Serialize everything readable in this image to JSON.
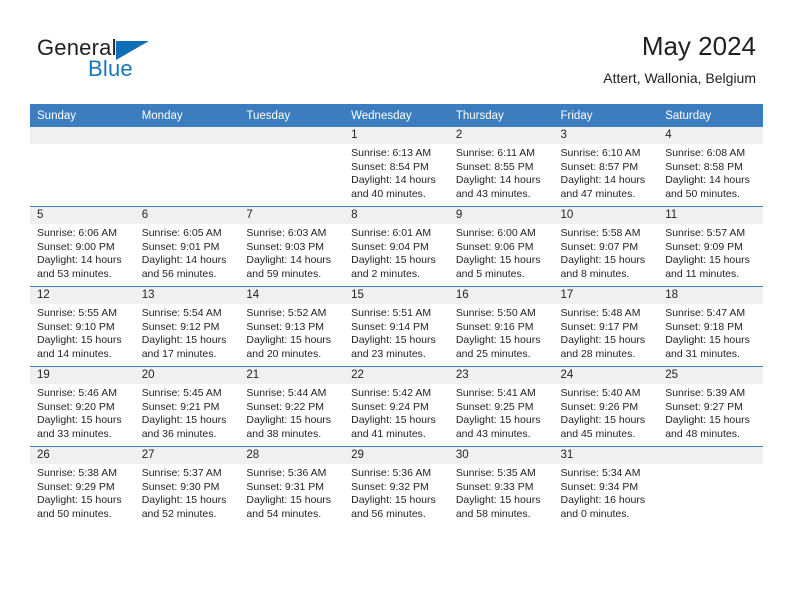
{
  "brand": {
    "name_part1": "General",
    "name_part2": "Blue",
    "triangle_color": "#0e6eb8",
    "blue_color": "#1b75bb"
  },
  "header": {
    "title": "May 2024",
    "subtitle": "Attert, Wallonia, Belgium"
  },
  "theme": {
    "header_row_bg": "#3b7dbf",
    "daynum_band_bg": "#f0f0f0",
    "text_color": "#231f20"
  },
  "weekday_headers": [
    "Sunday",
    "Monday",
    "Tuesday",
    "Wednesday",
    "Thursday",
    "Friday",
    "Saturday"
  ],
  "weeks": [
    [
      {
        "empty": true
      },
      {
        "empty": true
      },
      {
        "empty": true
      },
      {
        "day": "1",
        "sunrise": "Sunrise: 6:13 AM",
        "sunset": "Sunset: 8:54 PM",
        "daylight1": "Daylight: 14 hours",
        "daylight2": "and 40 minutes."
      },
      {
        "day": "2",
        "sunrise": "Sunrise: 6:11 AM",
        "sunset": "Sunset: 8:55 PM",
        "daylight1": "Daylight: 14 hours",
        "daylight2": "and 43 minutes."
      },
      {
        "day": "3",
        "sunrise": "Sunrise: 6:10 AM",
        "sunset": "Sunset: 8:57 PM",
        "daylight1": "Daylight: 14 hours",
        "daylight2": "and 47 minutes."
      },
      {
        "day": "4",
        "sunrise": "Sunrise: 6:08 AM",
        "sunset": "Sunset: 8:58 PM",
        "daylight1": "Daylight: 14 hours",
        "daylight2": "and 50 minutes."
      }
    ],
    [
      {
        "day": "5",
        "sunrise": "Sunrise: 6:06 AM",
        "sunset": "Sunset: 9:00 PM",
        "daylight1": "Daylight: 14 hours",
        "daylight2": "and 53 minutes."
      },
      {
        "day": "6",
        "sunrise": "Sunrise: 6:05 AM",
        "sunset": "Sunset: 9:01 PM",
        "daylight1": "Daylight: 14 hours",
        "daylight2": "and 56 minutes."
      },
      {
        "day": "7",
        "sunrise": "Sunrise: 6:03 AM",
        "sunset": "Sunset: 9:03 PM",
        "daylight1": "Daylight: 14 hours",
        "daylight2": "and 59 minutes."
      },
      {
        "day": "8",
        "sunrise": "Sunrise: 6:01 AM",
        "sunset": "Sunset: 9:04 PM",
        "daylight1": "Daylight: 15 hours",
        "daylight2": "and 2 minutes."
      },
      {
        "day": "9",
        "sunrise": "Sunrise: 6:00 AM",
        "sunset": "Sunset: 9:06 PM",
        "daylight1": "Daylight: 15 hours",
        "daylight2": "and 5 minutes."
      },
      {
        "day": "10",
        "sunrise": "Sunrise: 5:58 AM",
        "sunset": "Sunset: 9:07 PM",
        "daylight1": "Daylight: 15 hours",
        "daylight2": "and 8 minutes."
      },
      {
        "day": "11",
        "sunrise": "Sunrise: 5:57 AM",
        "sunset": "Sunset: 9:09 PM",
        "daylight1": "Daylight: 15 hours",
        "daylight2": "and 11 minutes."
      }
    ],
    [
      {
        "day": "12",
        "sunrise": "Sunrise: 5:55 AM",
        "sunset": "Sunset: 9:10 PM",
        "daylight1": "Daylight: 15 hours",
        "daylight2": "and 14 minutes."
      },
      {
        "day": "13",
        "sunrise": "Sunrise: 5:54 AM",
        "sunset": "Sunset: 9:12 PM",
        "daylight1": "Daylight: 15 hours",
        "daylight2": "and 17 minutes."
      },
      {
        "day": "14",
        "sunrise": "Sunrise: 5:52 AM",
        "sunset": "Sunset: 9:13 PM",
        "daylight1": "Daylight: 15 hours",
        "daylight2": "and 20 minutes."
      },
      {
        "day": "15",
        "sunrise": "Sunrise: 5:51 AM",
        "sunset": "Sunset: 9:14 PM",
        "daylight1": "Daylight: 15 hours",
        "daylight2": "and 23 minutes."
      },
      {
        "day": "16",
        "sunrise": "Sunrise: 5:50 AM",
        "sunset": "Sunset: 9:16 PM",
        "daylight1": "Daylight: 15 hours",
        "daylight2": "and 25 minutes."
      },
      {
        "day": "17",
        "sunrise": "Sunrise: 5:48 AM",
        "sunset": "Sunset: 9:17 PM",
        "daylight1": "Daylight: 15 hours",
        "daylight2": "and 28 minutes."
      },
      {
        "day": "18",
        "sunrise": "Sunrise: 5:47 AM",
        "sunset": "Sunset: 9:18 PM",
        "daylight1": "Daylight: 15 hours",
        "daylight2": "and 31 minutes."
      }
    ],
    [
      {
        "day": "19",
        "sunrise": "Sunrise: 5:46 AM",
        "sunset": "Sunset: 9:20 PM",
        "daylight1": "Daylight: 15 hours",
        "daylight2": "and 33 minutes."
      },
      {
        "day": "20",
        "sunrise": "Sunrise: 5:45 AM",
        "sunset": "Sunset: 9:21 PM",
        "daylight1": "Daylight: 15 hours",
        "daylight2": "and 36 minutes."
      },
      {
        "day": "21",
        "sunrise": "Sunrise: 5:44 AM",
        "sunset": "Sunset: 9:22 PM",
        "daylight1": "Daylight: 15 hours",
        "daylight2": "and 38 minutes."
      },
      {
        "day": "22",
        "sunrise": "Sunrise: 5:42 AM",
        "sunset": "Sunset: 9:24 PM",
        "daylight1": "Daylight: 15 hours",
        "daylight2": "and 41 minutes."
      },
      {
        "day": "23",
        "sunrise": "Sunrise: 5:41 AM",
        "sunset": "Sunset: 9:25 PM",
        "daylight1": "Daylight: 15 hours",
        "daylight2": "and 43 minutes."
      },
      {
        "day": "24",
        "sunrise": "Sunrise: 5:40 AM",
        "sunset": "Sunset: 9:26 PM",
        "daylight1": "Daylight: 15 hours",
        "daylight2": "and 45 minutes."
      },
      {
        "day": "25",
        "sunrise": "Sunrise: 5:39 AM",
        "sunset": "Sunset: 9:27 PM",
        "daylight1": "Daylight: 15 hours",
        "daylight2": "and 48 minutes."
      }
    ],
    [
      {
        "day": "26",
        "sunrise": "Sunrise: 5:38 AM",
        "sunset": "Sunset: 9:29 PM",
        "daylight1": "Daylight: 15 hours",
        "daylight2": "and 50 minutes."
      },
      {
        "day": "27",
        "sunrise": "Sunrise: 5:37 AM",
        "sunset": "Sunset: 9:30 PM",
        "daylight1": "Daylight: 15 hours",
        "daylight2": "and 52 minutes."
      },
      {
        "day": "28",
        "sunrise": "Sunrise: 5:36 AM",
        "sunset": "Sunset: 9:31 PM",
        "daylight1": "Daylight: 15 hours",
        "daylight2": "and 54 minutes."
      },
      {
        "day": "29",
        "sunrise": "Sunrise: 5:36 AM",
        "sunset": "Sunset: 9:32 PM",
        "daylight1": "Daylight: 15 hours",
        "daylight2": "and 56 minutes."
      },
      {
        "day": "30",
        "sunrise": "Sunrise: 5:35 AM",
        "sunset": "Sunset: 9:33 PM",
        "daylight1": "Daylight: 15 hours",
        "daylight2": "and 58 minutes."
      },
      {
        "day": "31",
        "sunrise": "Sunrise: 5:34 AM",
        "sunset": "Sunset: 9:34 PM",
        "daylight1": "Daylight: 16 hours",
        "daylight2": "and 0 minutes."
      },
      {
        "empty": true
      }
    ]
  ]
}
